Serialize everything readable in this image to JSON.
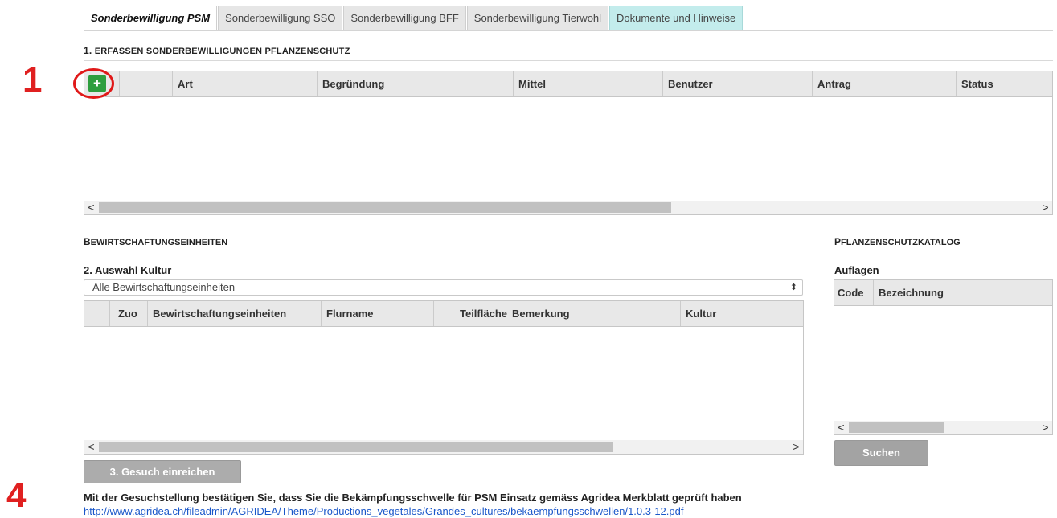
{
  "tabs": [
    {
      "label": "Sonderbewilligung PSM",
      "active": true
    },
    {
      "label": "Sonderbewilligung SSO",
      "active": false
    },
    {
      "label": "Sonderbewilligung BFF",
      "active": false
    },
    {
      "label": "Sonderbewilligung Tierwohl",
      "active": false
    },
    {
      "label": "Dokumente und Hinweise",
      "active": false
    }
  ],
  "section1": {
    "title_num": "1.",
    "title_text": "ERFASSEN SONDERBEWILLIGUNGEN PFLANZENSCHUTZ",
    "add_icon": "+",
    "columns": [
      "Art",
      "Begründung",
      "Mittel",
      "Benutzer",
      "Antrag",
      "Status"
    ]
  },
  "bew": {
    "title_big": "B",
    "title_rest": "EWIRTSCHAFTUNGSEINHEITEN",
    "subtitle": "2. Auswahl Kultur",
    "select_value": "Alle Bewirtschaftungseinheiten",
    "select_arrow": "⬍",
    "columns": [
      "Zuo",
      "Bewirtschaftungseinheiten",
      "Flurname",
      "Teilfläche",
      "Bemerkung",
      "Kultur"
    ]
  },
  "katalog": {
    "title_big": "P",
    "title_rest": "FLANZENSCHUTZKATALOG",
    "subtitle": "Auflagen",
    "columns": [
      "Code",
      "Bezeichnung"
    ],
    "search_label": "Suchen"
  },
  "scroll": {
    "left": "<",
    "right": ">"
  },
  "markers": {
    "one": "1",
    "four": "4"
  },
  "submit_label": "3. Gesuch einreichen",
  "footer": {
    "notice": "Mit der Gesuchstellung bestätigen Sie, dass Sie die Bekämpfungsschwelle für PSM Einsatz gemäss Agridea Merkblatt geprüft haben",
    "link": "http://www.agridea.ch/fileadmin/AGRIDEA/Theme/Productions_vegetales/Grandes_cultures/bekaempfungsschwellen/1.0.3-12.pdf"
  },
  "colors": {
    "accent_green": "#2e9e3e",
    "marker_red": "#e02020",
    "info_tab": "#c3ecec",
    "link": "#1a57c9"
  }
}
